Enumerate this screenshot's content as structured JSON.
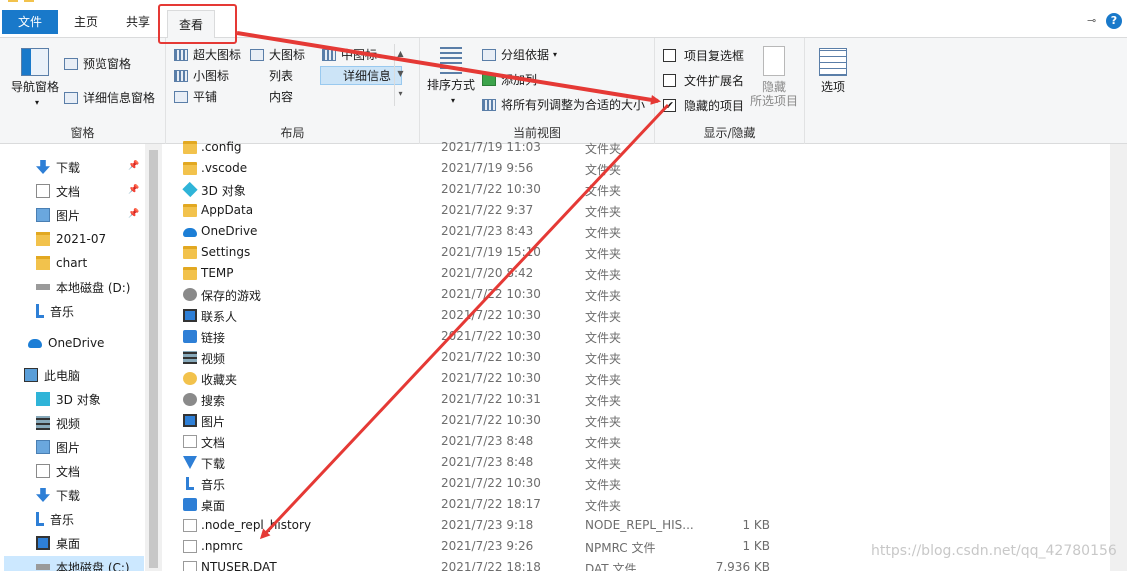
{
  "tabs": {
    "file": "文件",
    "home": "主页",
    "share": "共享",
    "view": "查看",
    "help": "?"
  },
  "ribbon": {
    "panes": {
      "label": "窗格",
      "nav_pane": "导航窗格",
      "preview_pane": "预览窗格",
      "details_pane": "详细信息窗格"
    },
    "layout": {
      "label": "布局",
      "items": [
        "超大图标",
        "大图标",
        "中图标",
        "小图标",
        "列表",
        "详细信息",
        "平铺",
        "内容"
      ],
      "selected": "详细信息"
    },
    "current_view": {
      "label": "当前视图",
      "sort_by": "排序方式",
      "group_by": "分组依据",
      "add_columns": "添加列",
      "fit_columns": "将所有列调整为合适的大小"
    },
    "show_hide": {
      "label": "显示/隐藏",
      "item_checkboxes": "项目复选框",
      "file_extensions": "文件扩展名",
      "hidden_items": "隐藏的项目",
      "hidden_items_checked": true,
      "hide_selected_1": "隐藏",
      "hide_selected_2": "所选项目"
    },
    "options": "选项"
  },
  "nav": {
    "items": [
      {
        "label": "下载",
        "icon": "download-icon",
        "pinned": true
      },
      {
        "label": "文档",
        "icon": "document-icon",
        "pinned": true
      },
      {
        "label": "图片",
        "icon": "pictures-icon",
        "pinned": true
      },
      {
        "label": "2021-07",
        "icon": "folder-icon",
        "pinned": false
      },
      {
        "label": "chart",
        "icon": "folder-icon",
        "pinned": false
      },
      {
        "label": "本地磁盘 (D:)",
        "icon": "drive-icon",
        "pinned": false
      },
      {
        "label": "音乐",
        "icon": "music-icon",
        "pinned": false
      },
      {
        "label": "OneDrive",
        "icon": "onedrive-icon",
        "pinned": false
      },
      {
        "label": "此电脑",
        "icon": "computer-icon",
        "pinned": false
      },
      {
        "label": "3D 对象",
        "icon": "3d-objects-icon",
        "pinned": false
      },
      {
        "label": "视频",
        "icon": "video-icon",
        "pinned": false
      },
      {
        "label": "图片",
        "icon": "pictures-icon",
        "pinned": false
      },
      {
        "label": "文档",
        "icon": "document-icon",
        "pinned": false
      },
      {
        "label": "下载",
        "icon": "download-icon",
        "pinned": false
      },
      {
        "label": "音乐",
        "icon": "music-icon",
        "pinned": false
      },
      {
        "label": "桌面",
        "icon": "desktop-icon",
        "pinned": false
      },
      {
        "label": "本地磁盘 (C:)",
        "icon": "drive-icon",
        "pinned": false,
        "selected": true
      }
    ]
  },
  "files": [
    {
      "name": ".config",
      "date": "2021/7/19 11:03",
      "type": "文件夹",
      "size": "",
      "icon": "folder"
    },
    {
      "name": ".vscode",
      "date": "2021/7/19 9:56",
      "type": "文件夹",
      "size": "",
      "icon": "folder"
    },
    {
      "name": "3D 对象",
      "date": "2021/7/22 10:30",
      "type": "文件夹",
      "size": "",
      "icon": "cube"
    },
    {
      "name": "AppData",
      "date": "2021/7/22 9:37",
      "type": "文件夹",
      "size": "",
      "icon": "folder"
    },
    {
      "name": "OneDrive",
      "date": "2021/7/23 8:43",
      "type": "文件夹",
      "size": "",
      "icon": "cloud"
    },
    {
      "name": "Settings",
      "date": "2021/7/19 15:10",
      "type": "文件夹",
      "size": "",
      "icon": "folder"
    },
    {
      "name": "TEMP",
      "date": "2021/7/20 8:42",
      "type": "文件夹",
      "size": "",
      "icon": "folder"
    },
    {
      "name": "保存的游戏",
      "date": "2021/7/22 10:30",
      "type": "文件夹",
      "size": "",
      "icon": "gray"
    },
    {
      "name": "联系人",
      "date": "2021/7/22 10:30",
      "type": "文件夹",
      "size": "",
      "icon": "screen"
    },
    {
      "name": "链接",
      "date": "2021/7/22 10:30",
      "type": "文件夹",
      "size": "",
      "icon": "blue"
    },
    {
      "name": "视频",
      "date": "2021/7/22 10:30",
      "type": "文件夹",
      "size": "",
      "icon": "film"
    },
    {
      "name": "收藏夹",
      "date": "2021/7/22 10:30",
      "type": "文件夹",
      "size": "",
      "icon": "star"
    },
    {
      "name": "搜索",
      "date": "2021/7/22 10:31",
      "type": "文件夹",
      "size": "",
      "icon": "gray"
    },
    {
      "name": "图片",
      "date": "2021/7/22 10:30",
      "type": "文件夹",
      "size": "",
      "icon": "screen"
    },
    {
      "name": "文档",
      "date": "2021/7/23 8:48",
      "type": "文件夹",
      "size": "",
      "icon": "doc"
    },
    {
      "name": "下载",
      "date": "2021/7/23 8:48",
      "type": "文件夹",
      "size": "",
      "icon": "arrow"
    },
    {
      "name": "音乐",
      "date": "2021/7/22 10:30",
      "type": "文件夹",
      "size": "",
      "icon": "note"
    },
    {
      "name": "桌面",
      "date": "2021/7/22 18:17",
      "type": "文件夹",
      "size": "",
      "icon": "blue"
    },
    {
      "name": ".node_repl_history",
      "date": "2021/7/23 9:18",
      "type": "NODE_REPL_HIS...",
      "size": "1 KB",
      "icon": "doc"
    },
    {
      "name": ".npmrc",
      "date": "2021/7/23 9:26",
      "type": "NPMRC 文件",
      "size": "1 KB",
      "icon": "doc"
    },
    {
      "name": "NTUSER.DAT",
      "date": "2021/7/22 18:18",
      "type": "DAT 文件",
      "size": "7,936 KB",
      "icon": "doc"
    }
  ],
  "watermark": "https://blog.csdn.net/qq_42780156",
  "colors": {
    "accent": "#1979ca",
    "annotation_red": "#e53935",
    "selection": "#cce8ff"
  }
}
